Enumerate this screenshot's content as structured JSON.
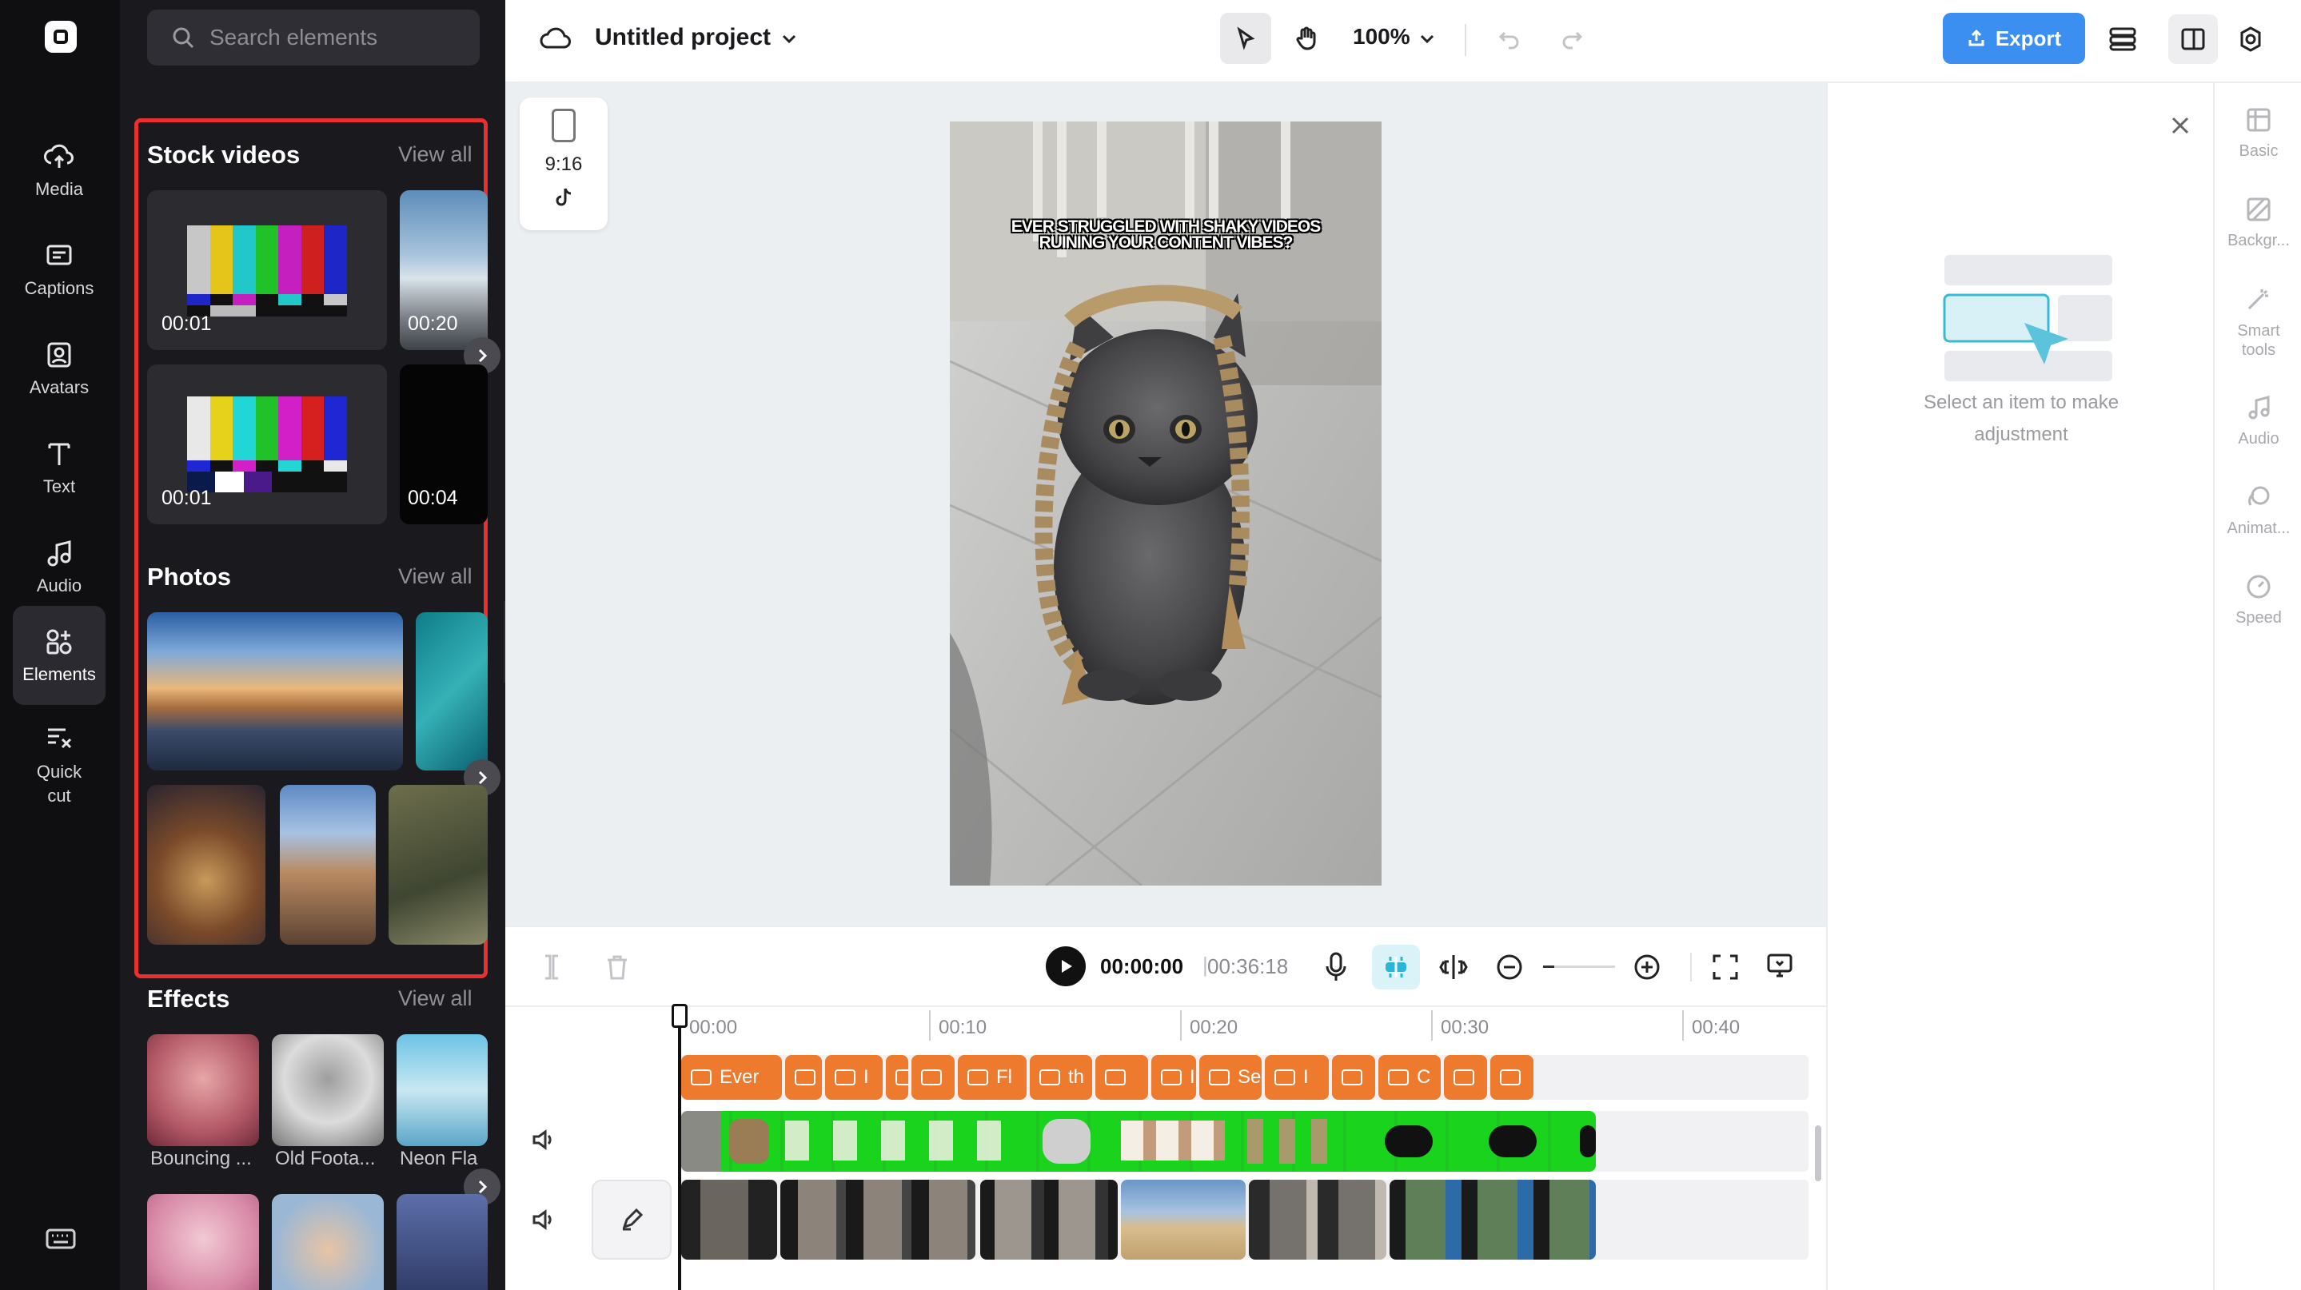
{
  "nav": {
    "items": [
      {
        "label": "Media",
        "icon": "cloud-upload-icon"
      },
      {
        "label": "Captions",
        "icon": "captions-icon"
      },
      {
        "label": "Avatars",
        "icon": "avatar-icon"
      },
      {
        "label": "Text",
        "icon": "text-icon"
      },
      {
        "label": "Audio",
        "icon": "music-note-icon"
      },
      {
        "label": "Elements",
        "icon": "elements-icon"
      },
      {
        "label": "Quick cut",
        "icon": "quick-cut-icon"
      }
    ],
    "active": "Elements"
  },
  "panel": {
    "search_placeholder": "Search elements",
    "stock_videos": {
      "title": "Stock videos",
      "view_all": "View all",
      "items": [
        {
          "duration": "00:01"
        },
        {
          "duration": "00:20"
        },
        {
          "duration": "00:01"
        },
        {
          "duration": "00:04"
        }
      ]
    },
    "photos": {
      "title": "Photos",
      "view_all": "View all"
    },
    "effects": {
      "title": "Effects",
      "view_all": "View all",
      "items": [
        {
          "label": "Bouncing ..."
        },
        {
          "label": "Old Foota..."
        },
        {
          "label": "Neon Fla"
        }
      ]
    }
  },
  "topbar": {
    "project_title": "Untitled project",
    "zoom": "100%",
    "export_label": "Export"
  },
  "canvas": {
    "aspect_ratio": "9:16",
    "caption": "EVER STRUGGLED WITH SHAKY VIDEOS RUINING YOUR CONTENT VIBES?"
  },
  "properties": {
    "empty_message_line1": "Select an item to make",
    "empty_message_line2": "adjustment"
  },
  "right_sidebar": {
    "items": [
      {
        "label": "Basic"
      },
      {
        "label": "Backgr..."
      },
      {
        "label": "Smart tools"
      },
      {
        "label": "Audio"
      },
      {
        "label": "Animat..."
      },
      {
        "label": "Speed"
      }
    ]
  },
  "timeline": {
    "current_time": "00:00:00",
    "separator": "|",
    "total_time": "00:36:18",
    "ruler": [
      "00:00",
      "00:10",
      "00:20",
      "00:30",
      "00:40"
    ],
    "caption_clips": [
      "Ever",
      "",
      "I",
      "",
      "",
      "Fl",
      "th",
      "",
      "Ir",
      "Se",
      "I",
      "",
      "C",
      "",
      ""
    ]
  },
  "colors": {
    "accent": "#3a8ff0",
    "caption_clip": "#ee7a2d",
    "highlight": "#e8312f",
    "green_screen": "#19d31d"
  }
}
